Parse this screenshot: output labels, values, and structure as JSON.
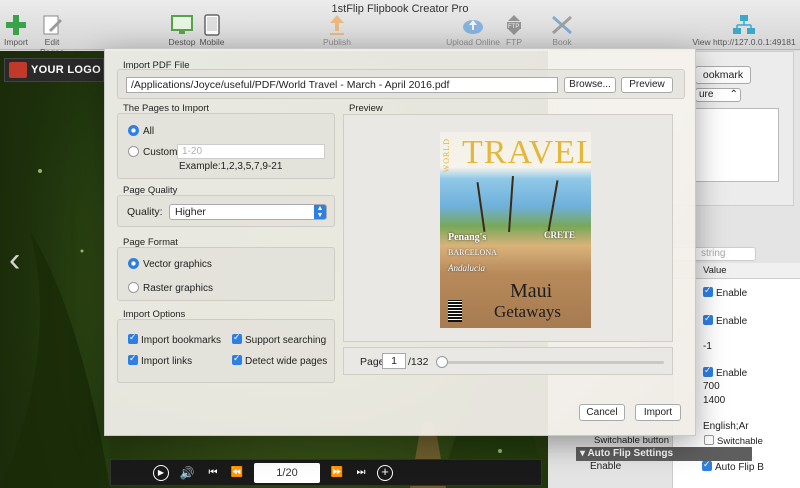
{
  "app": {
    "title": "1stFlip Flipbook Creator Pro"
  },
  "toolbar": {
    "import_label": "Import",
    "edit_pages_label": "Edit Pages",
    "desktop_label": "Destop",
    "mobile_label": "Mobile",
    "publish_label": "Publish",
    "upload_online_label": "Upload Online",
    "ftp_label": "FTP",
    "book_management_label": "Book Management",
    "view_http_label": "View http://127.0.0.1:49181"
  },
  "flipbook": {
    "logo_text": "YOUR LOGO",
    "page_indicator": "1/20"
  },
  "dialog": {
    "import_pdf_title": "Import PDF File",
    "pdf_path": "/Applications/Joyce/useful/PDF/World Travel - March - April 2016.pdf",
    "browse_label": "Browse...",
    "preview_button_label": "Preview",
    "pages_title": "The Pages to Import",
    "all_label": "All",
    "custom_label": "Custom",
    "custom_placeholder": "1-20",
    "custom_example": "Example:1,2,3,5,7,9-21",
    "quality_title": "Page Quality",
    "quality_label": "Quality:",
    "quality_value": "Higher",
    "format_title": "Page Format",
    "vector_label": "Vector graphics",
    "raster_label": "Raster graphics",
    "options_title": "Import Options",
    "import_bookmarks_label": "Import bookmarks",
    "support_searching_label": "Support searching",
    "import_links_label": "Import links",
    "detect_wide_label": "Detect wide pages",
    "preview_title": "Preview",
    "page_label": "Page",
    "page_value": "1",
    "page_total": "/132",
    "page_position": 0.0,
    "cancel_label": "Cancel",
    "import_label": "Import",
    "selected": {
      "pages": "all",
      "format": "vector"
    },
    "checked": {
      "import_bookmarks": true,
      "support_searching": true,
      "import_links": true,
      "detect_wide": true
    }
  },
  "cover": {
    "world": "WORLD",
    "travel": "TRAVEL",
    "line1": "Penang's",
    "line2": "BARCELONA",
    "line3": "Andalucia",
    "crete": "CRETE",
    "maui": "Maui",
    "getaways": "Getaways"
  },
  "right_panel": {
    "bookmark_btn": "ookmark",
    "select_value": "ure",
    "search_placeholder": "string",
    "value_header": "Value",
    "rows": [
      {
        "label": "Enable",
        "checked": true
      },
      {
        "label": "Enable",
        "checked": true
      },
      {
        "label": "-1"
      },
      {
        "label": "Enable",
        "checked": true
      },
      {
        "label": "700"
      },
      {
        "label": "1400"
      },
      {
        "label": "English;Ar"
      }
    ],
    "switchable_row_label": "Switchable button",
    "switchable_value": "Switchable",
    "auto_flip_title": "Auto Flip Settings",
    "auto_flip_enable_label": "Enable",
    "auto_flip_value": "Auto Flip B"
  },
  "colors": {
    "accent": "#2f7fe0",
    "cover_title": "#e3b73a"
  }
}
